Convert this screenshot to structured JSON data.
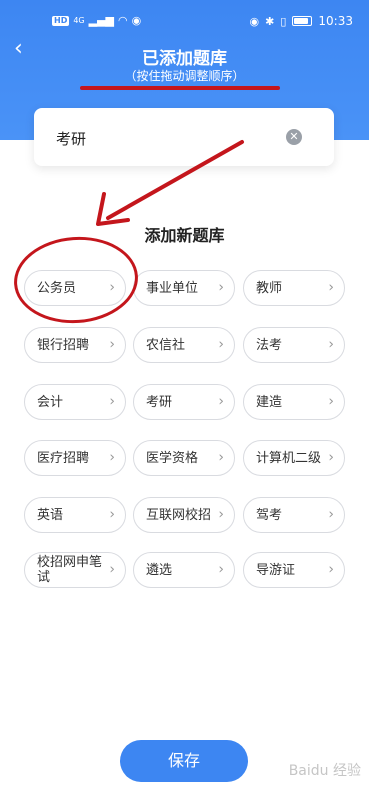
{
  "status_bar": {
    "time": "10:33",
    "badge_hd": "HD",
    "badge_net": "4G"
  },
  "header": {
    "title": "已添加题库",
    "subtitle": "（按住拖动调整顺序）"
  },
  "selected": {
    "items": [
      {
        "label": "考研"
      }
    ]
  },
  "section": {
    "title": "添加新题库"
  },
  "chips": [
    {
      "label": "公务员"
    },
    {
      "label": "事业单位"
    },
    {
      "label": "教师"
    },
    {
      "label": "银行招聘"
    },
    {
      "label": "农信社"
    },
    {
      "label": "法考"
    },
    {
      "label": "会计"
    },
    {
      "label": "考研"
    },
    {
      "label": "建造"
    },
    {
      "label": "医疗招聘"
    },
    {
      "label": "医学资格"
    },
    {
      "label": "计算机二级"
    },
    {
      "label": "英语"
    },
    {
      "label": "互联网校招"
    },
    {
      "label": "驾考"
    },
    {
      "label": "校招网申笔试"
    },
    {
      "label": "遴选"
    },
    {
      "label": "导游证"
    }
  ],
  "footer": {
    "save_label": "保存"
  },
  "watermark": "Baidu 经验",
  "colors": {
    "accent": "#3d86f2",
    "annotation": "#c4161c"
  }
}
